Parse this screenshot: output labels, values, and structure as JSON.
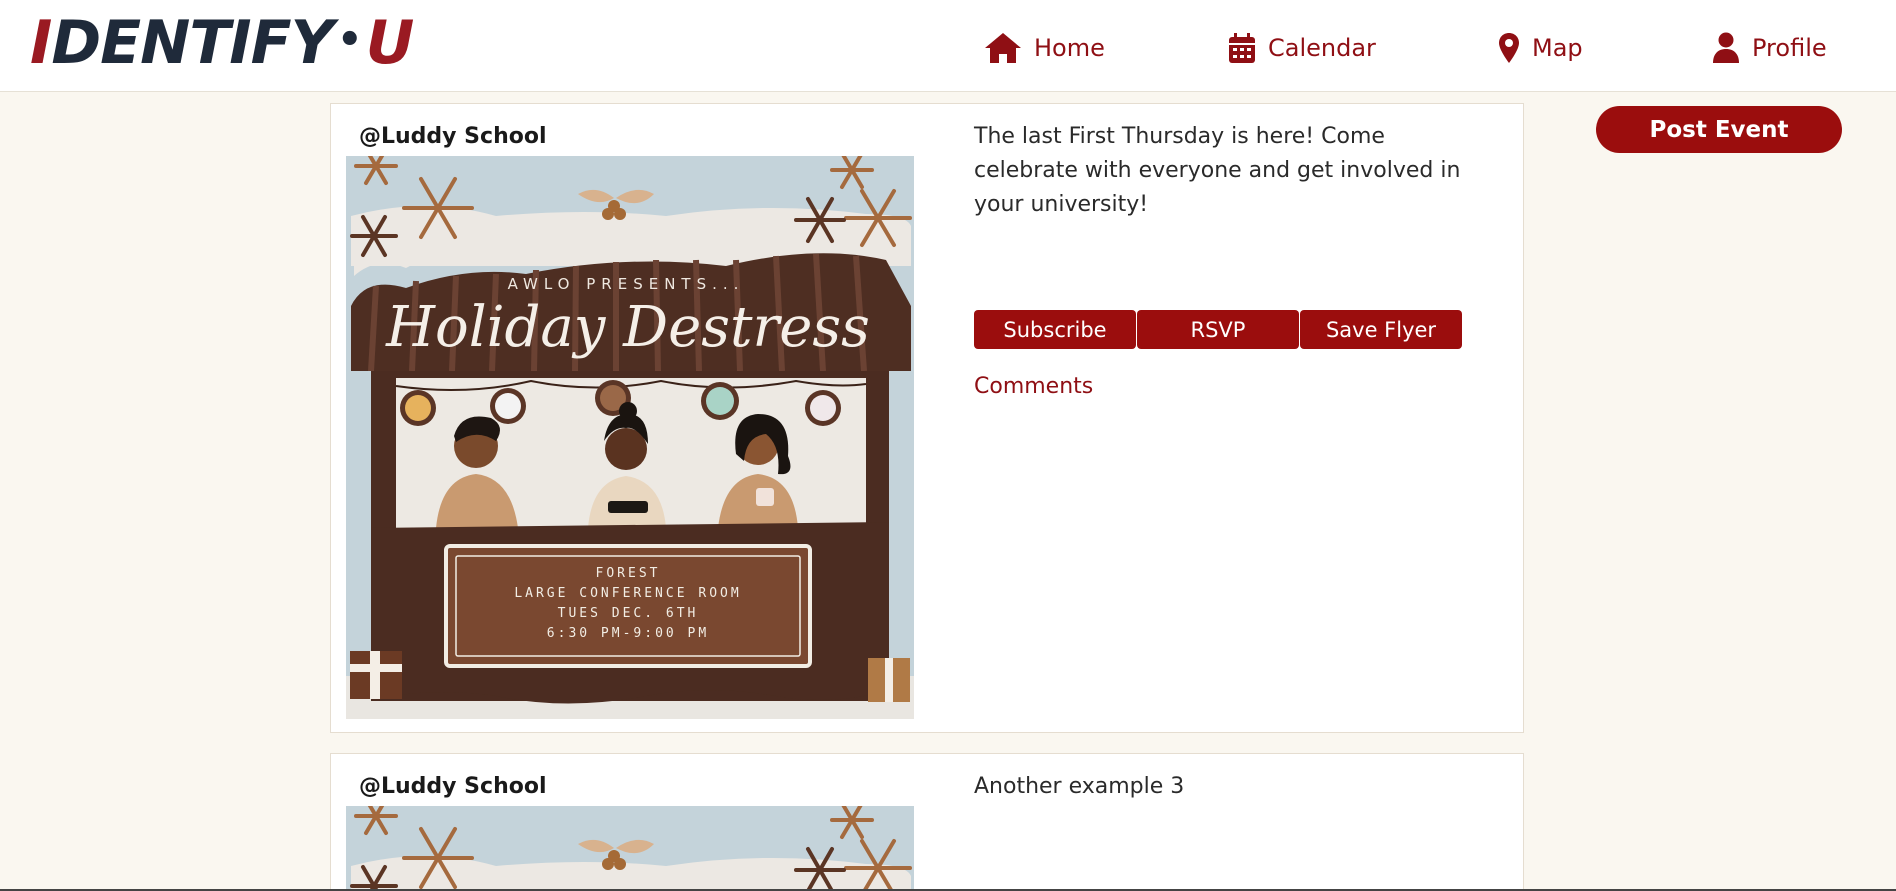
{
  "brand": {
    "logo_left": "I",
    "logo_main": "DENTIFY",
    "logo_dot": "•",
    "logo_right": "U"
  },
  "nav": {
    "home": {
      "label": "Home",
      "icon": "home-icon"
    },
    "calendar": {
      "label": "Calendar",
      "icon": "calendar-icon"
    },
    "map": {
      "label": "Map",
      "icon": "map-pin-icon"
    },
    "profile": {
      "label": "Profile",
      "icon": "user-icon"
    }
  },
  "actions": {
    "post_event": "Post Event"
  },
  "posts": [
    {
      "author": "@Luddy School",
      "description": "The last First Thursday is here! Come celebrate with everyone and get involved in your university!",
      "buttons": {
        "subscribe": "Subscribe",
        "rsvp": "RSVP",
        "save": "Save Flyer"
      },
      "comments": "Comments",
      "flyer": {
        "presenter": "AWLO PRESENTS...",
        "title": "Holiday Destress",
        "details": [
          "FOREST",
          "LARGE CONFERENCE ROOM",
          "TUES DEC. 6TH",
          "6:30 PM-9:00 PM"
        ]
      }
    },
    {
      "author": "@Luddy School",
      "description": "Another example 3"
    }
  ],
  "colors": {
    "accent": "#9b0d0d",
    "navy": "#1f2a3a",
    "background": "#faf7f0"
  }
}
